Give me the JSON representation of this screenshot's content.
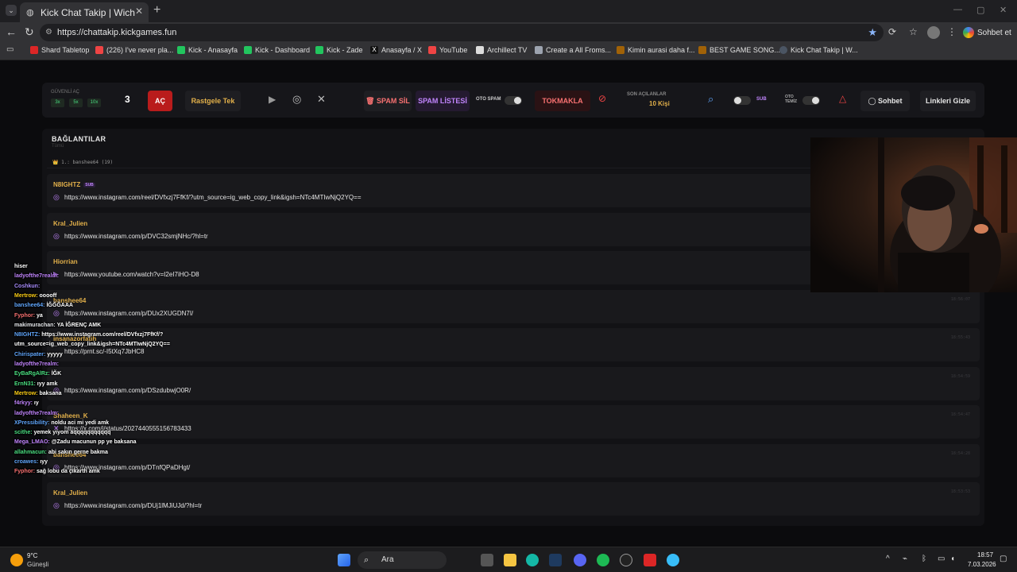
{
  "browser": {
    "tab_title": "Kick Chat Takip | Wich",
    "url": "https://chattakip.kickgames.fun",
    "side_button": "Sohbet et",
    "bookmarks": [
      "Shard Tabletop",
      "(226) I've never pla...",
      "Kick - Anasayfa",
      "Kick - Dashboard",
      "Kick - Zade",
      "Anasayfa / X",
      "YouTube",
      "Archillect TV",
      "Create a All Froms...",
      "Kimin aurasi daha f...",
      "BEST GAME SONG...",
      "Kick Chat Takip | W..."
    ]
  },
  "toolbar": {
    "safe_open_label": "GÜVENLİ AÇ",
    "multipliers": [
      "3x",
      "5x",
      "10x"
    ],
    "count": "3",
    "open_button": "AÇ",
    "random_button": "Rastgele Tek",
    "spam_delete": "SPAM SİL",
    "spam_list": "SPAM LİSTESİ",
    "auto_spam": "OTO SPAM",
    "tokmakla": "TOKMAKLA",
    "recent_label": "SON AÇILANLAR",
    "recent_value": "10 Kişi",
    "sub_label": "SUB",
    "auto_clean": "OTO TEMİZ",
    "chat_button": "Sohbet",
    "hide_links_button": "Linkleri Gizle"
  },
  "panel": {
    "title": "BAĞLANTILAR",
    "subtitle": "Tümü",
    "filter": "👑 1.: banshee64 (19)",
    "rows": [
      {
        "user": "N8IGHTZ",
        "sub": "SUB",
        "prefix": "◎",
        "url": "https://www.instagram.com/reel/DVfxzj7FfKf/?utm_source=ig_web_copy_link&igsh=NTc4MTIwNjQ2YQ==",
        "time": ""
      },
      {
        "user": "Kral_Julien",
        "sub": "",
        "prefix": "◎",
        "url": "https://www.instagram.com/p/DVC32smjNHc/?hl=tr",
        "time": ""
      },
      {
        "user": "Hiorrian",
        "sub": "",
        "prefix": "▶",
        "url": "https://www.youtube.com/watch?v=I2eI7iHO-D8",
        "time": ""
      },
      {
        "user": "banshee64",
        "sub": "",
        "prefix": "◎",
        "url": "https://www.instagram.com/p/DUx2XUGDN7I/",
        "time": "18:56:07"
      },
      {
        "user": "insanazorfatih",
        "sub": "",
        "prefix": "",
        "url": "https://prnt.sc/-I5tXq7JbHC8",
        "time": "18:55:43"
      },
      {
        "user": "",
        "sub": "",
        "prefix": "◎",
        "url": "https://www.instagram.com/p/DSzdubwjO0R/",
        "time": "18:54:59"
      },
      {
        "user": "Shaheen_K",
        "sub": "",
        "prefix": "✕",
        "url": "https://x.com/i/status/2027440555156783433",
        "time": "18:54:47"
      },
      {
        "user": "banshee64",
        "sub": "",
        "prefix": "◎",
        "url": "https://www.instagram.com/p/DTnfQPaDHgt/",
        "time": "18:54:28"
      },
      {
        "user": "Kral_Julien",
        "sub": "",
        "prefix": "◎",
        "url": "https://www.instagram.com/p/DUj1lMJiUJd/?hl=tr",
        "time": "18:53:53"
      }
    ]
  },
  "chat": [
    {
      "user": "hiser",
      "msg": "",
      "color": "#ffffff"
    },
    {
      "user": "ladyofthe7realm:",
      "msg": "",
      "color": "#c084fc"
    },
    {
      "user": "Coshkun:",
      "msg": "",
      "color": "#a78bfa"
    },
    {
      "user": "Mertrow:",
      "msg": "ooooff",
      "color": "#facc15"
    },
    {
      "user": "banshee64:",
      "msg": "İĞĞĞAAA",
      "color": "#60a5fa"
    },
    {
      "user": "Fyphor:",
      "msg": "ya",
      "color": "#f87171"
    },
    {
      "user": "makimurachan:",
      "msg": "YA İĞRENÇ AMK",
      "color": "#e5e7eb"
    },
    {
      "user": "N8IGHTZ:",
      "msg": "https://www.instagram.com/reel/DVfxzj7FfKf/?",
      "color": "#60a5fa"
    },
    {
      "user": "utm_source=ig_web_copy_link&igsh=NTc4MTIwNjQ2YQ==",
      "msg": "",
      "color": "#ffffff"
    },
    {
      "user": "Chirispater:",
      "msg": "yyyyy",
      "color": "#60a5fa"
    },
    {
      "user": "ladyofthe7realm:",
      "msg": "",
      "color": "#c084fc"
    },
    {
      "user": "EyBaRgAlRz:",
      "msg": "İĞK",
      "color": "#4ade80"
    },
    {
      "user": "ErnN31:",
      "msg": "ıyy amk",
      "color": "#4ade80"
    },
    {
      "user": "Mertrow:",
      "msg": "baksana",
      "color": "#facc15"
    },
    {
      "user": "f4rkyy:",
      "msg": "ıy",
      "color": "#c084fc"
    },
    {
      "user": "ladyofthe7realm:",
      "msg": "",
      "color": "#c084fc"
    },
    {
      "user": "XPressibility:",
      "msg": "noldu aci mi yedi amk",
      "color": "#60a5fa"
    },
    {
      "user": "scithe:",
      "msg": "yemek yiyom aqqqqqqqqqqq",
      "color": "#4ade80"
    },
    {
      "user": "Mega_LMAO:",
      "msg": "@Zadu macunun pp ye baksana",
      "color": "#c084fc"
    },
    {
      "user": "allahmacun:",
      "msg": "abi sakın gerne bakma",
      "color": "#4ade80"
    },
    {
      "user": "croawes:",
      "msg": "ıyy",
      "color": "#60a5fa"
    },
    {
      "user": "Fyphor:",
      "msg": "sağ lobu da çıkarth amk",
      "color": "#f87171"
    }
  ],
  "taskbar": {
    "weather_temp": "9°C",
    "weather_desc": "Güneşli",
    "search": "Ara",
    "time": "18:57",
    "date": "7.03.2026"
  },
  "colors": {
    "accent_red": "#b91c1c",
    "accent_yellow": "#e2b04a",
    "accent_purple": "#c084fc"
  }
}
